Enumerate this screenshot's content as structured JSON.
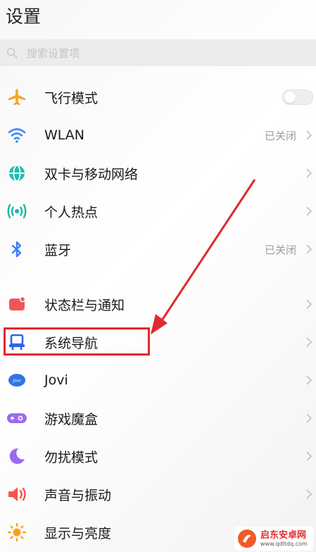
{
  "header": {
    "title": "设置"
  },
  "search": {
    "placeholder": "搜索设置项"
  },
  "items": [
    {
      "label": "飞行模式",
      "icon": "airplane-icon",
      "control": "toggle",
      "on": false
    },
    {
      "label": "WLAN",
      "icon": "wifi-icon",
      "value": "已关闭"
    },
    {
      "label": "双卡与移动网络",
      "icon": "globe-icon"
    },
    {
      "label": "个人热点",
      "icon": "hotspot-icon"
    },
    {
      "label": "蓝牙",
      "icon": "bluetooth-icon",
      "value": "已关闭"
    },
    {
      "label": "状态栏与通知",
      "icon": "notification-icon"
    },
    {
      "label": "系统导航",
      "icon": "navigation-icon",
      "highlighted": true
    },
    {
      "label": "Jovi",
      "icon": "jovi-icon"
    },
    {
      "label": "游戏魔盒",
      "icon": "gamepad-icon"
    },
    {
      "label": "勿扰模式",
      "icon": "moon-icon"
    },
    {
      "label": "声音与振动",
      "icon": "speaker-icon"
    },
    {
      "label": "显示与亮度",
      "icon": "sun-icon"
    }
  ],
  "watermark": {
    "name": "启东安卓网",
    "url": "www.qdltdq.com"
  },
  "colors": {
    "airplane": "#f5a623",
    "wifi": "#3d8af7",
    "globe": "#1fbfae",
    "hotspot": "#19b8a6",
    "bluetooth": "#3d7df5",
    "notification": "#f1555c",
    "navigation": "#2f66e0",
    "jovi": "#2f74e8",
    "gamepad": "#9d6bf0",
    "moon": "#9a6af2",
    "speaker": "#f2574a",
    "sun": "#f7a21c",
    "annotation": "#e0292f"
  }
}
